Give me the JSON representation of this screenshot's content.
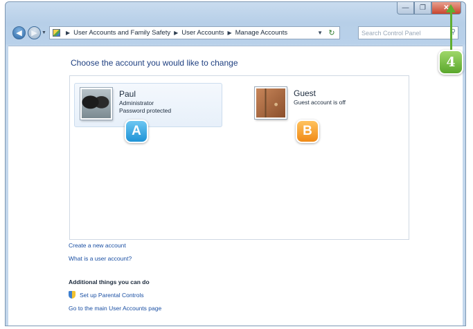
{
  "window": {
    "caption": {
      "minimize_glyph": "—",
      "maximize_glyph": "❐",
      "close_glyph": "✕"
    }
  },
  "navigation": {
    "back_glyph": "◀",
    "forward_glyph": "▶",
    "recent_glyph": "▼",
    "refresh_glyph": "↻"
  },
  "address_bar": {
    "icon": "control-panel-icon",
    "breadcrumb": [
      "User Accounts and Family Safety",
      "User Accounts",
      "Manage Accounts"
    ],
    "separator": "▶",
    "dropdown_glyph": "▼"
  },
  "search": {
    "placeholder": "Search Control Panel",
    "icon": "search-icon",
    "icon_glyph": "⚲"
  },
  "main": {
    "title": "Choose the account you would like to change",
    "accounts": [
      {
        "name": "Paul",
        "lines": [
          "Administrator",
          "Password protected"
        ],
        "picture": "dogs-picture",
        "selected": true
      },
      {
        "name": "Guest",
        "lines": [
          "Guest account is off"
        ],
        "picture": "guest-door-picture",
        "selected": false
      }
    ],
    "links": {
      "create": "Create a new account",
      "what_is": "What is a user account?"
    },
    "additional": {
      "heading": "Additional things you can do",
      "parental": "Set up Parental Controls",
      "main_page": "Go to the main User Accounts page"
    }
  },
  "callouts": {
    "a": "A",
    "b": "B",
    "four": "4"
  },
  "colors": {
    "link": "#1a4fa3",
    "title": "#1e3f80",
    "callout_a": "#1f93d6",
    "callout_b": "#f08a16",
    "callout_4": "#5aa72c"
  }
}
